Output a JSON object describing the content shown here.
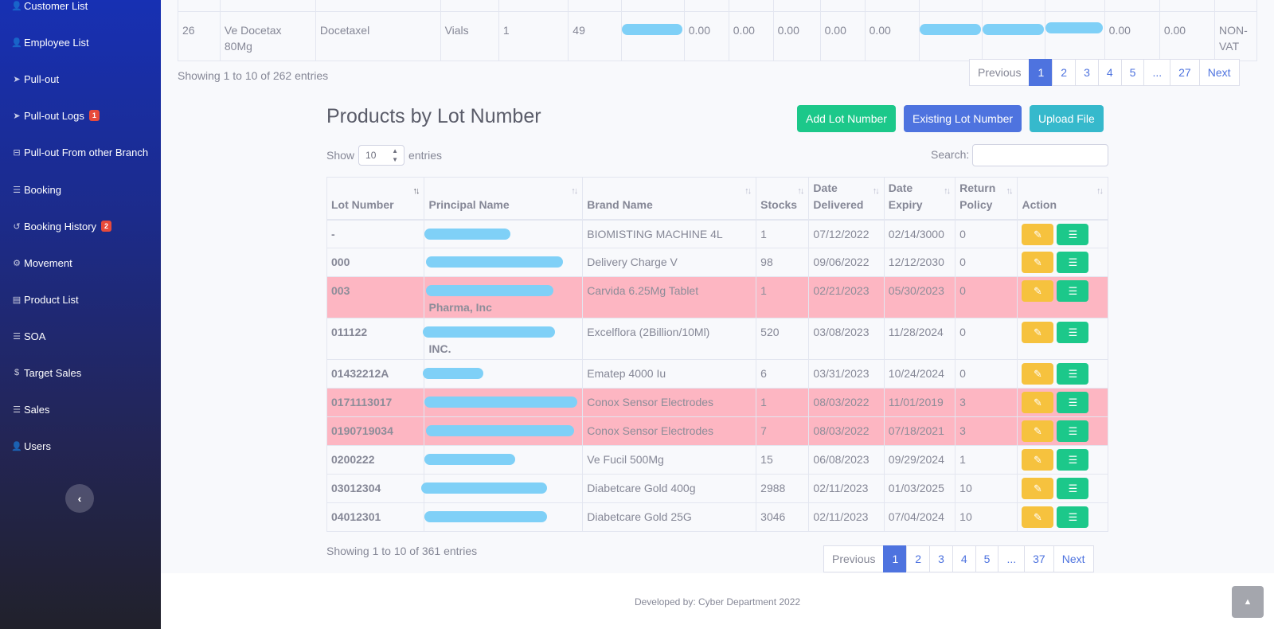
{
  "sidebar": {
    "items": [
      {
        "label": "Customer List",
        "icon": "user-icon",
        "glyph": "👤"
      },
      {
        "label": "Employee List",
        "icon": "user-icon",
        "glyph": "👤"
      },
      {
        "label": "Pull-out",
        "icon": "paper-plane-icon",
        "glyph": "➤"
      },
      {
        "label": "Pull-out Logs",
        "icon": "paper-plane-icon",
        "glyph": "➤",
        "badge": "1"
      },
      {
        "label": "Pull-out From other Branch",
        "icon": "inbox-icon",
        "glyph": "⊟"
      },
      {
        "label": "Booking",
        "icon": "list-icon",
        "glyph": "☰"
      },
      {
        "label": "Booking History",
        "icon": "history-icon",
        "glyph": "↺",
        "badge": "2"
      },
      {
        "label": "Movement",
        "icon": "cogs-icon",
        "glyph": "⚙"
      },
      {
        "label": "Product List",
        "icon": "clipboard-icon",
        "glyph": "▤"
      },
      {
        "label": "SOA",
        "icon": "list-icon",
        "glyph": "☰"
      },
      {
        "label": "Target Sales",
        "icon": "dollar-icon",
        "glyph": "$"
      },
      {
        "label": "Sales",
        "icon": "list-icon",
        "glyph": "☰"
      },
      {
        "label": "Users",
        "icon": "user-icon",
        "glyph": "👤"
      }
    ],
    "collapse_glyph": "‹"
  },
  "top_table": {
    "partial_row": [
      "",
      "",
      "",
      "",
      "",
      "",
      "",
      "",
      "",
      "",
      "",
      "",
      "",
      "",
      "",
      "",
      "",
      "",
      ""
    ],
    "row": {
      "num": "26",
      "name": "Ve Docetax 80Mg",
      "generic": "Docetaxel",
      "unit": "Vials",
      "qty": "1",
      "stock": "49",
      "v1": "0.00",
      "v2": "0.00",
      "v3": "0.00",
      "v4": "0.00",
      "v5": "0.00",
      "v6": "0.00",
      "v7": "0.00",
      "vat": "NON-VAT"
    },
    "info": "Showing 1 to 10 of 262 entries",
    "pager": [
      "Previous",
      "1",
      "2",
      "3",
      "4",
      "5",
      "...",
      "27",
      "Next"
    ]
  },
  "lot_section": {
    "title": "Products by Lot Number",
    "buttons": {
      "add": "Add Lot Number",
      "existing": "Existing Lot Number",
      "upload": "Upload File"
    },
    "show_label": "Show",
    "show_value": "10",
    "entries_label": "entries",
    "search_label": "Search:",
    "headers": {
      "lot": "Lot Number",
      "principal": "Principal Name",
      "brand": "Brand Name",
      "stocks": "Stocks",
      "delivered_1": "Date",
      "delivered_2": "Delivered",
      "expiry_1": "Date",
      "expiry_2": "Expiry",
      "return_1": "Return",
      "return_2": "Policy",
      "action": "Action"
    },
    "rows": [
      {
        "lot": "-",
        "principal_suffix": "",
        "brand": "BIOMISTING MACHINE 4L",
        "stocks": "1",
        "delivered": "07/12/2022",
        "expiry": "02/14/3000",
        "ret": "0",
        "danger": false
      },
      {
        "lot": "000",
        "principal_suffix": "",
        "brand": "Delivery Charge V",
        "stocks": "98",
        "delivered": "09/06/2022",
        "expiry": "12/12/2030",
        "ret": "0",
        "danger": false
      },
      {
        "lot": "003",
        "principal_suffix": "Pharma, Inc",
        "brand": "Carvida 6.25Mg Tablet",
        "stocks": "1",
        "delivered": "02/21/2023",
        "expiry": "05/30/2023",
        "ret": "0",
        "danger": true
      },
      {
        "lot": "011122",
        "principal_suffix": "INC.",
        "brand": "Excelflora (2Billion/10Ml)",
        "stocks": "520",
        "delivered": "03/08/2023",
        "expiry": "11/28/2024",
        "ret": "0",
        "danger": false
      },
      {
        "lot": "01432212A",
        "principal_suffix": "",
        "brand": "Ematep 4000 Iu",
        "stocks": "6",
        "delivered": "03/31/2023",
        "expiry": "10/24/2024",
        "ret": "0",
        "danger": false
      },
      {
        "lot": "0171113017",
        "principal_suffix": "",
        "brand": "Conox Sensor Electrodes",
        "stocks": "1",
        "delivered": "08/03/2022",
        "expiry": "11/01/2019",
        "ret": "3",
        "danger": true
      },
      {
        "lot": "0190719034",
        "principal_suffix": "",
        "brand": "Conox Sensor Electrodes",
        "stocks": "7",
        "delivered": "08/03/2022",
        "expiry": "07/18/2021",
        "ret": "3",
        "danger": true
      },
      {
        "lot": "0200222",
        "principal_suffix": "",
        "brand": "Ve Fucil 500Mg",
        "stocks": "15",
        "delivered": "06/08/2023",
        "expiry": "09/29/2024",
        "ret": "1",
        "danger": false
      },
      {
        "lot": "03012304",
        "principal_suffix": "",
        "brand": "Diabetcare Gold 400g",
        "stocks": "2988",
        "delivered": "02/11/2023",
        "expiry": "01/03/2025",
        "ret": "10",
        "danger": false
      },
      {
        "lot": "04012301",
        "principal_suffix": "",
        "brand": "Diabetcare Gold 25G",
        "stocks": "3046",
        "delivered": "02/11/2023",
        "expiry": "07/04/2024",
        "ret": "10",
        "danger": false
      }
    ],
    "info": "Showing 1 to 10 of 361 entries",
    "pager": [
      "Previous",
      "1",
      "2",
      "3",
      "4",
      "5",
      "...",
      "37",
      "Next"
    ]
  },
  "footer": {
    "text": "Developed by: Cyber Department 2022"
  },
  "colors": {
    "primary": "#4e73df",
    "success": "#1cc88a",
    "info": "#36b9cc",
    "warning": "#f6c23e",
    "danger_row": "#fdb6c2",
    "redaction": "#7fd0f7"
  }
}
